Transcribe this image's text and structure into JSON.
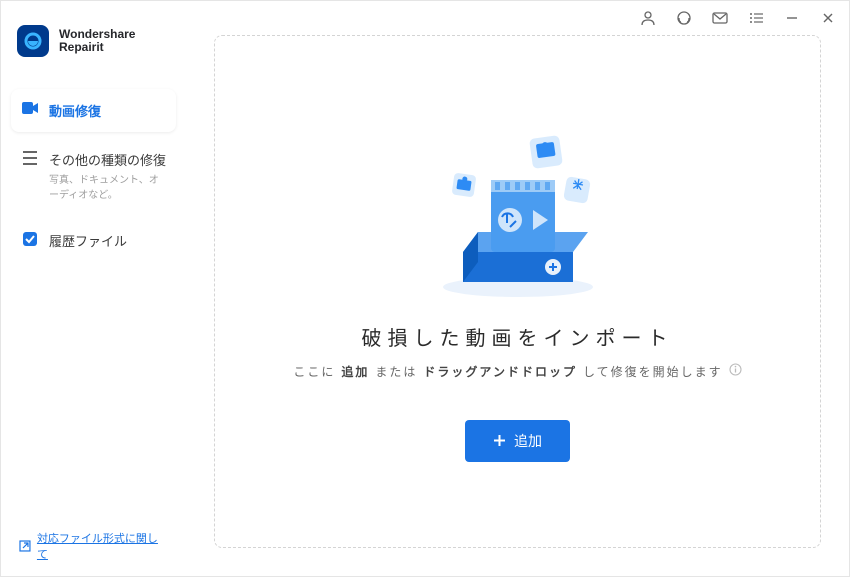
{
  "app": {
    "name_line1": "Wondershare",
    "name_line2": "Repairit"
  },
  "sidebar": {
    "items": [
      {
        "icon": "video-icon",
        "label": "動画修復"
      },
      {
        "icon": "grid-icon",
        "label": "その他の種類の修復",
        "sub": "写真、ドキュメント、オーディオなど。"
      },
      {
        "icon": "check-icon",
        "label": "履歴ファイル"
      }
    ],
    "footer": {
      "label": "対応ファイル形式に関して"
    }
  },
  "main": {
    "heading": "破損した動画をインポート",
    "desc_prefix": "ここに",
    "desc_bold1": "追加",
    "desc_mid": "または",
    "desc_bold2": "ドラッグアンドドロップ",
    "desc_suffix": "して修復を開始します",
    "add_button": "追加"
  },
  "toolbar": {
    "icons": [
      "user-icon",
      "support-icon",
      "mail-icon",
      "menu-icon",
      "minimize-icon",
      "close-icon"
    ]
  }
}
